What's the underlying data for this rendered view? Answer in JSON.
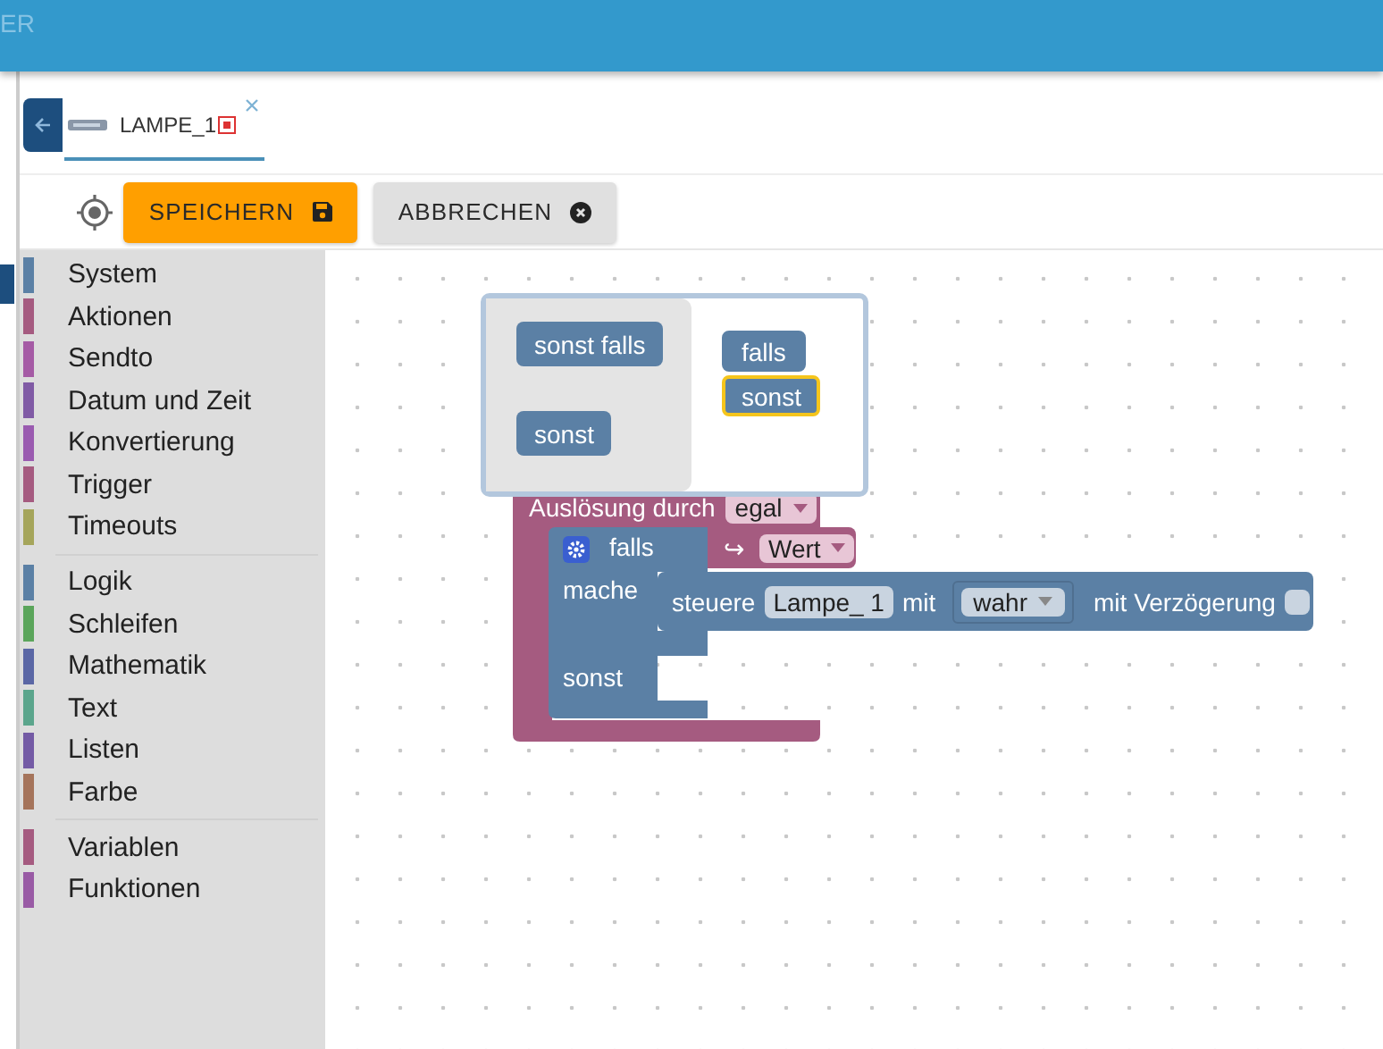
{
  "header": {
    "title": "ER"
  },
  "tab": {
    "label": "LAMPE_1",
    "selected": true
  },
  "toolbar": {
    "buttons": [
      {
        "label": "SPEICHERN",
        "kind": "save"
      },
      {
        "label": "ABBRECHEN",
        "kind": "cancel"
      }
    ]
  },
  "toolbox": {
    "groups": [
      {
        "items": [
          {
            "label": "System",
            "color": "#5b80a5"
          },
          {
            "label": "Aktionen",
            "color": "#a55b80"
          },
          {
            "label": "Sendto",
            "color": "#a55ba5"
          },
          {
            "label": "Datum und Zeit",
            "color": "#805ba5"
          },
          {
            "label": "Konvertierung",
            "color": "#9a5bb0"
          },
          {
            "label": "Trigger",
            "color": "#a55b80"
          },
          {
            "label": "Timeouts",
            "color": "#a5a55b"
          }
        ]
      },
      {
        "items": [
          {
            "label": "Logik",
            "color": "#5b80a5"
          },
          {
            "label": "Schleifen",
            "color": "#5ba55b"
          },
          {
            "label": "Mathematik",
            "color": "#5b67a5"
          },
          {
            "label": "Text",
            "color": "#5ba58c"
          },
          {
            "label": "Listen",
            "color": "#745ba5"
          },
          {
            "label": "Farbe",
            "color": "#a5745b"
          }
        ]
      },
      {
        "items": [
          {
            "label": "Variablen",
            "color": "#a55b80"
          },
          {
            "label": "Funktionen",
            "color": "#995ba5"
          }
        ]
      }
    ]
  },
  "workspace": {
    "mutator": {
      "palette": [
        {
          "label": "sonst falls"
        },
        {
          "label": "sonst"
        }
      ],
      "stack": [
        {
          "label": "falls",
          "selected": false
        },
        {
          "label": "sonst",
          "selected": true
        }
      ]
    },
    "trigger_block": {
      "label": "Auslösung durch",
      "field": "egal"
    },
    "if_block": {
      "if_label": "falls",
      "do_label": "mache",
      "else_label": "sonst"
    },
    "value_block": {
      "symbol": "↪",
      "field": "Wert"
    },
    "control_block": {
      "label": "steuere",
      "device": "Lampe_ 1",
      "with_label": "mit",
      "value": "wahr",
      "delay_label": "mit Verzögerung",
      "delay_checked": false
    }
  }
}
